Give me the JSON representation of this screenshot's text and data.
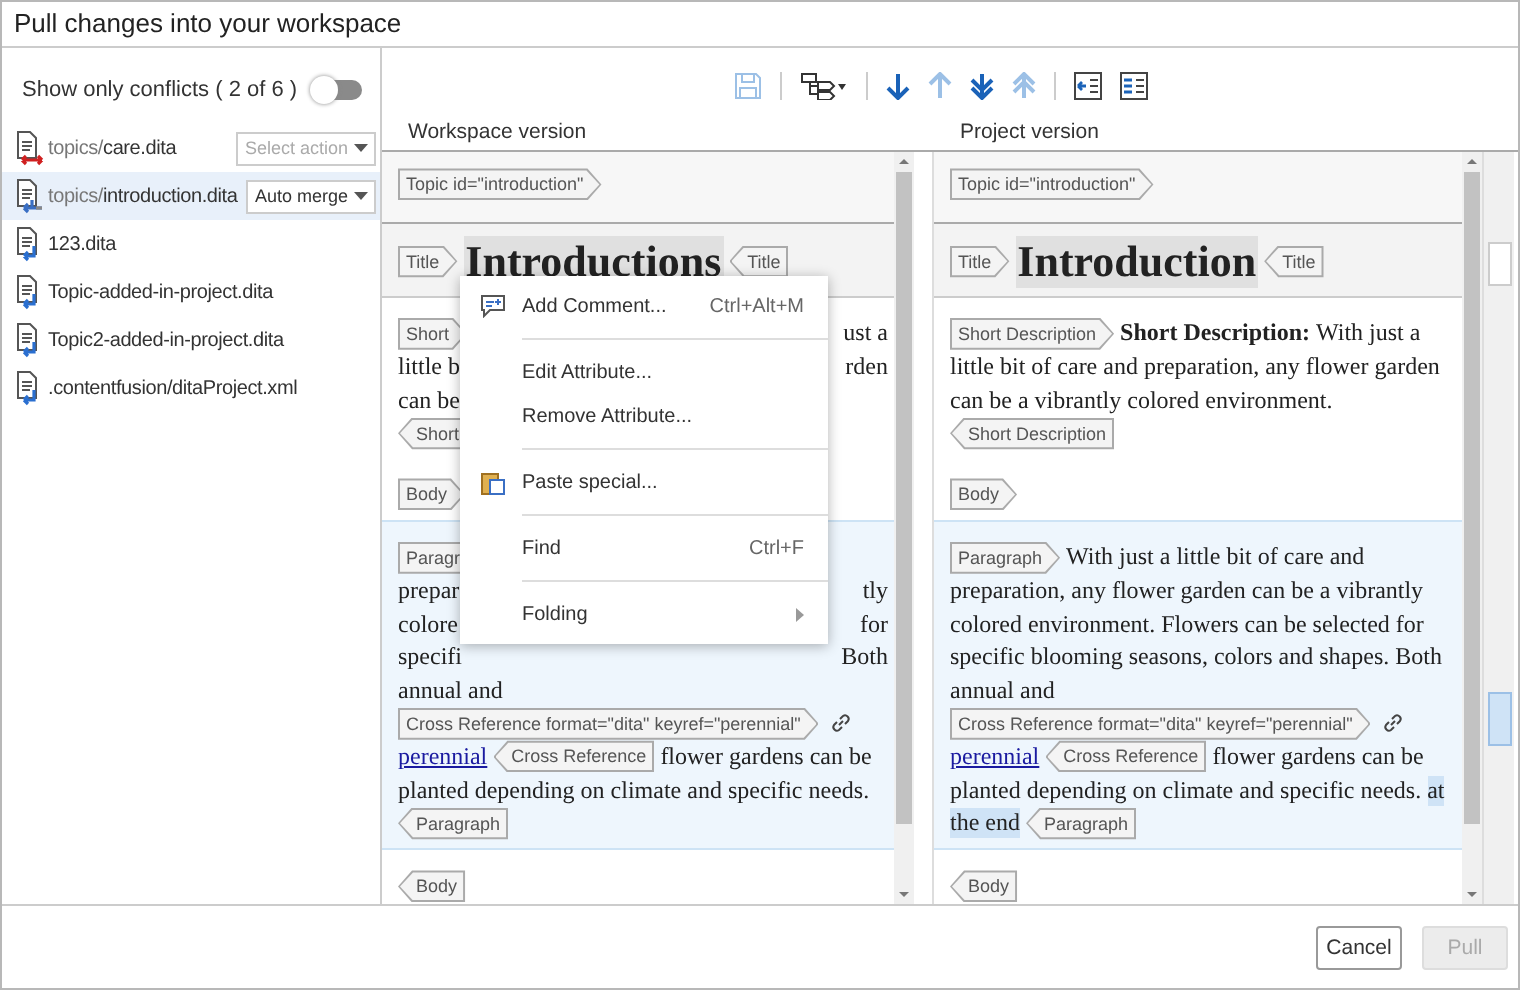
{
  "window": {
    "title": "Pull changes into your workspace"
  },
  "filter": {
    "label": "Show only conflicts ( 2 of 6 )",
    "on": false
  },
  "files": [
    {
      "folder": "topics/",
      "name": "care.dita",
      "kind": "conflict",
      "action": "Select action",
      "action_chosen": false,
      "selected": false
    },
    {
      "folder": "topics/",
      "name": "introduction.dita",
      "kind": "merged",
      "action": "Auto merge",
      "action_chosen": true,
      "selected": true
    },
    {
      "name": "123.dita",
      "kind": "incoming",
      "selected": false
    },
    {
      "name": "Topic-added-in-project.dita",
      "kind": "incoming",
      "selected": false
    },
    {
      "name": "Topic2-added-in-project.dita",
      "kind": "incoming",
      "selected": false
    },
    {
      "name": ".contentfusion/ditaProject.xml",
      "kind": "incoming",
      "selected": false
    }
  ],
  "toolbar": [
    {
      "kind": "save",
      "disabled": true
    },
    {
      "kind": "separator"
    },
    {
      "kind": "tree",
      "disabled": false
    },
    {
      "kind": "separator"
    },
    {
      "kind": "next",
      "disabled": false
    },
    {
      "kind": "previous",
      "disabled": true
    },
    {
      "kind": "last",
      "disabled": false
    },
    {
      "kind": "first",
      "disabled": true
    },
    {
      "kind": "separator"
    },
    {
      "kind": "copy-change",
      "disabled": false
    },
    {
      "kind": "copy-all",
      "disabled": false
    }
  ],
  "panes": [
    {
      "heading": "Workspace version",
      "blocks": [
        {
          "kind": "header",
          "selected": false,
          "lines": [
            {
              "segments": [
                {
                  "kind": "tag-start",
                  "text": "Topic id=\"introduction\""
                }
              ]
            }
          ]
        },
        {
          "kind": "title",
          "selected": false,
          "lines": [
            {
              "segments": [
                {
                  "kind": "tag-start",
                  "text": "Title"
                },
                {
                  "kind": "heading",
                  "text": "Introductions"
                },
                {
                  "kind": "tag-end",
                  "text": "Title"
                }
              ]
            }
          ]
        },
        {
          "kind": "plain",
          "selected": false,
          "lines": [
            {
              "segments": [
                {
                  "kind": "tag-start",
                  "text": "Short"
                }
              ],
              "right": [
                {
                  "kind": "text",
                  "text": "ust a"
                }
              ]
            },
            {
              "segments": [
                {
                  "kind": "text",
                  "text": "little b"
                }
              ],
              "right": [
                {
                  "kind": "text",
                  "text": "rden"
                }
              ]
            },
            {
              "segments": [
                {
                  "kind": "text",
                  "text": "can be"
                }
              ]
            },
            {
              "segments": [
                {
                  "kind": "tag-end",
                  "text": "Short"
                }
              ]
            }
          ]
        },
        {
          "kind": "plain",
          "selected": false,
          "lines": [
            {
              "segments": [
                {
                  "kind": "tag-start",
                  "text": "Body"
                }
              ]
            }
          ]
        },
        {
          "kind": "plain",
          "selected": true,
          "lines": [
            {
              "segments": [
                {
                  "kind": "tag-start",
                  "text": "Paragr"
                }
              ]
            },
            {
              "segments": [
                {
                  "kind": "text",
                  "text": "prepar"
                }
              ],
              "right": [
                {
                  "kind": "text",
                  "text": "tly"
                }
              ]
            },
            {
              "segments": [
                {
                  "kind": "text",
                  "text": "colore"
                }
              ],
              "right": [
                {
                  "kind": "text",
                  "text": "for"
                }
              ]
            },
            {
              "segments": [
                {
                  "kind": "text",
                  "text": "specifi"
                }
              ],
              "right": [
                {
                  "kind": "text",
                  "text": "Both"
                }
              ]
            },
            {
              "segments": [
                {
                  "kind": "text",
                  "text": "annual and"
                }
              ]
            },
            {
              "segments": [
                {
                  "kind": "tag-start",
                  "text": "Cross Reference format=\"dita\" keyref=\"perennial\""
                },
                {
                  "kind": "link-icon"
                }
              ]
            },
            {
              "segments": [
                {
                  "kind": "link",
                  "text": "perennial"
                },
                {
                  "kind": "tag-end",
                  "text": "Cross Reference"
                },
                {
                  "kind": "text",
                  "text": "flower gardens can be"
                }
              ]
            },
            {
              "segments": [
                {
                  "kind": "text",
                  "text": "planted depending on climate and specific needs."
                }
              ]
            },
            {
              "segments": [
                {
                  "kind": "tag-end",
                  "text": "Paragraph"
                }
              ]
            }
          ]
        },
        {
          "kind": "plain",
          "selected": false,
          "lines": [
            {
              "segments": [
                {
                  "kind": "tag-end",
                  "text": "Body"
                }
              ]
            }
          ]
        }
      ]
    },
    {
      "heading": "Project version",
      "blocks": [
        {
          "kind": "header",
          "selected": false,
          "lines": [
            {
              "segments": [
                {
                  "kind": "tag-start",
                  "text": "Topic id=\"introduction\""
                }
              ]
            }
          ]
        },
        {
          "kind": "title",
          "selected": false,
          "lines": [
            {
              "segments": [
                {
                  "kind": "tag-start",
                  "text": "Title"
                },
                {
                  "kind": "heading",
                  "text": "Introduction"
                },
                {
                  "kind": "tag-end",
                  "text": "Title"
                }
              ]
            }
          ]
        },
        {
          "kind": "plain",
          "selected": false,
          "lines": [
            {
              "segments": [
                {
                  "kind": "tag-start",
                  "text": "Short Description"
                },
                {
                  "kind": "bold",
                  "text": "Short Description:"
                },
                {
                  "kind": "text",
                  "text": "With just a"
                }
              ]
            },
            {
              "segments": [
                {
                  "kind": "text",
                  "text": "little bit of care and preparation, any flower garden"
                }
              ]
            },
            {
              "segments": [
                {
                  "kind": "text",
                  "text": "can be a vibrantly colored environment."
                }
              ]
            },
            {
              "segments": [
                {
                  "kind": "tag-end",
                  "text": "Short Description"
                }
              ]
            }
          ]
        },
        {
          "kind": "plain",
          "selected": false,
          "lines": [
            {
              "segments": [
                {
                  "kind": "tag-start",
                  "text": "Body"
                }
              ]
            }
          ]
        },
        {
          "kind": "plain",
          "selected": true,
          "lines": [
            {
              "segments": [
                {
                  "kind": "tag-start",
                  "text": "Paragraph"
                },
                {
                  "kind": "text",
                  "text": "With just a little bit of care and"
                }
              ]
            },
            {
              "segments": [
                {
                  "kind": "text",
                  "text": "preparation, any flower garden can be a vibrantly"
                }
              ]
            },
            {
              "segments": [
                {
                  "kind": "text",
                  "text": "colored environment. Flowers can be selected for"
                }
              ]
            },
            {
              "segments": [
                {
                  "kind": "text",
                  "text": "specific blooming seasons, colors and shapes. Both"
                }
              ]
            },
            {
              "segments": [
                {
                  "kind": "text",
                  "text": "annual and"
                }
              ]
            },
            {
              "segments": [
                {
                  "kind": "tag-start",
                  "text": "Cross Reference format=\"dita\" keyref=\"perennial\""
                },
                {
                  "kind": "link-icon"
                }
              ]
            },
            {
              "segments": [
                {
                  "kind": "link",
                  "text": "perennial"
                },
                {
                  "kind": "tag-end",
                  "text": "Cross Reference"
                },
                {
                  "kind": "text",
                  "text": "flower gardens can be"
                }
              ]
            },
            {
              "segments": [
                {
                  "kind": "text",
                  "text": "planted depending on climate and specific needs."
                },
                {
                  "kind": "highlight",
                  "text": "at"
                }
              ]
            },
            {
              "segments": [
                {
                  "kind": "highlight",
                  "text": "the end"
                },
                {
                  "kind": "tag-end",
                  "text": "Paragraph"
                }
              ]
            }
          ]
        },
        {
          "kind": "plain",
          "selected": false,
          "lines": [
            {
              "segments": [
                {
                  "kind": "tag-end",
                  "text": "Body"
                }
              ]
            }
          ]
        }
      ]
    }
  ],
  "context_menu": {
    "items": [
      {
        "kind": "comment",
        "label": "Add Comment...",
        "shortcut": "Ctrl+Alt+M"
      },
      {
        "kind": "separator"
      },
      {
        "kind": "plain",
        "label": "Edit Attribute..."
      },
      {
        "kind": "plain",
        "label": "Remove Attribute..."
      },
      {
        "kind": "separator"
      },
      {
        "kind": "paste",
        "label": "Paste special..."
      },
      {
        "kind": "separator"
      },
      {
        "kind": "plain",
        "label": "Find",
        "shortcut": "Ctrl+F"
      },
      {
        "kind": "separator"
      },
      {
        "kind": "submenu",
        "label": "Folding"
      }
    ]
  },
  "buttons": [
    {
      "label": "Cancel",
      "disabled": false
    },
    {
      "label": "Pull",
      "disabled": true
    }
  ]
}
